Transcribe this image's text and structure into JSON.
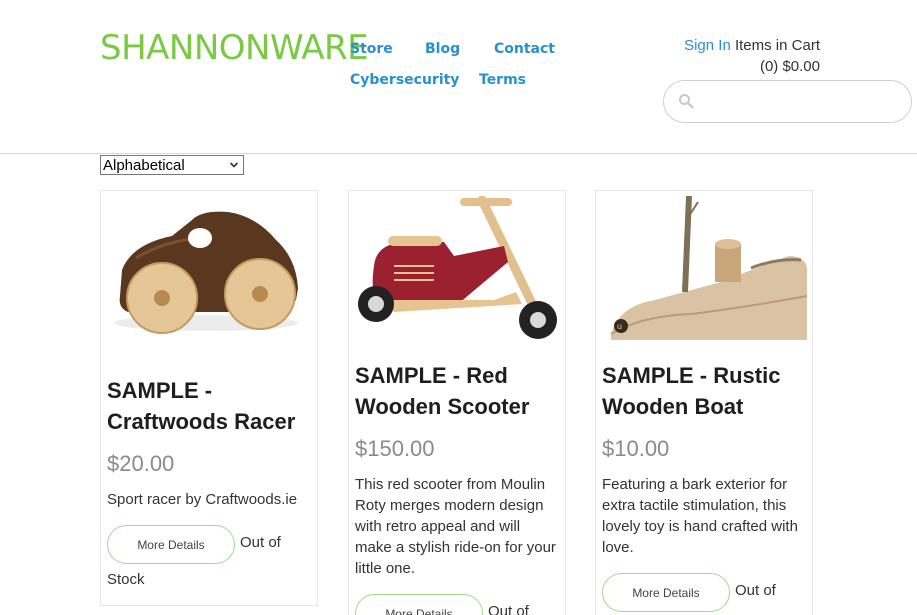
{
  "header": {
    "logo": "SHANNONWARE",
    "nav": {
      "store": "Store",
      "blog": "Blog",
      "contact": "Contact",
      "cybersecurity": "Cybersecurity",
      "terms": "Terms"
    },
    "account": {
      "sign_in": "Sign In",
      "items_in_cart": "Items in Cart",
      "cart_summary": "(0) $0.00"
    },
    "search": {
      "placeholder": "",
      "icon": "search-icon"
    }
  },
  "sort": {
    "selected": "Alphabetical"
  },
  "products": [
    {
      "title": "SAMPLE - Craftwoods Racer",
      "price": "$20.00",
      "description": "Sport racer by Craftwoods.ie",
      "button": "More Details",
      "stock_word1": "Out of",
      "stock_word2": "Stock"
    },
    {
      "title": "SAMPLE - Red Wooden Scooter",
      "price": "$150.00",
      "description": "This red scooter from Moulin Roty merges modern design with retro appeal and will make a stylish ride-on for your little one.",
      "button": "More Details",
      "stock_word1": "Out of"
    },
    {
      "title": "SAMPLE - Rustic Wooden Boat",
      "price": "$10.00",
      "description": "Featuring a bark exterior for extra tactile stimulation, this lovely toy is hand crafted with love.",
      "button": "More Details",
      "stock_word1": "Out of"
    }
  ],
  "colors": {
    "logo": "#7ac943",
    "link": "#2a8fd0",
    "price": "#8a8a8a",
    "button_border": "#9fd98a"
  }
}
